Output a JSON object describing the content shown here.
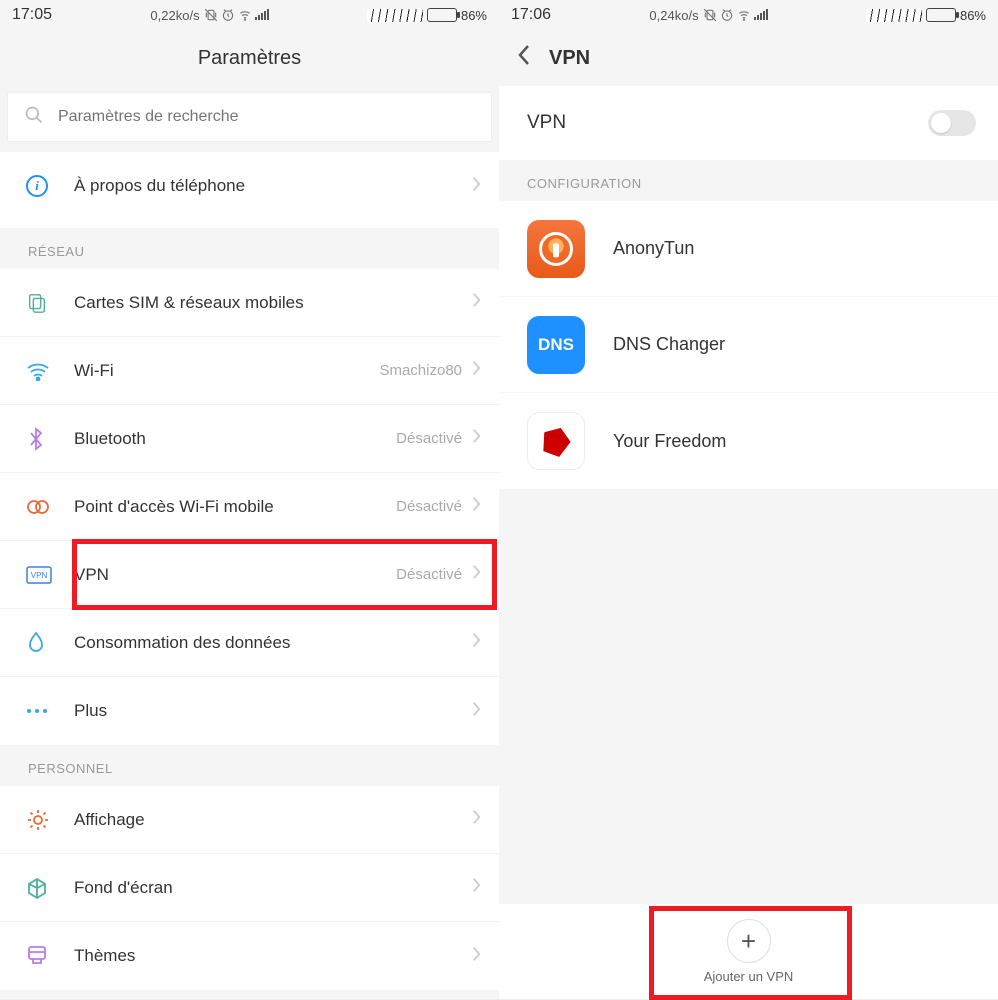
{
  "left": {
    "status": {
      "time": "17:05",
      "speed": "0,22ko/s",
      "battery": "86%"
    },
    "title": "Paramètres",
    "search_placeholder": "Paramètres de recherche",
    "about": "À propos du téléphone",
    "section_network": "RÉSEAU",
    "rows_network": [
      {
        "label": "Cartes SIM & réseaux mobiles",
        "value": ""
      },
      {
        "label": "Wi-Fi",
        "value": "Smachizo80"
      },
      {
        "label": "Bluetooth",
        "value": "Désactivé"
      },
      {
        "label": "Point d'accès Wi-Fi mobile",
        "value": "Désactivé"
      },
      {
        "label": "VPN",
        "value": "Désactivé"
      },
      {
        "label": "Consommation des données",
        "value": ""
      },
      {
        "label": "Plus",
        "value": ""
      }
    ],
    "section_personal": "PERSONNEL",
    "rows_personal": [
      {
        "label": "Affichage"
      },
      {
        "label": "Fond d'écran"
      },
      {
        "label": "Thèmes"
      }
    ]
  },
  "right": {
    "status": {
      "time": "17:06",
      "speed": "0,24ko/s",
      "battery": "86%"
    },
    "title": "VPN",
    "vpn_toggle_label": "VPN",
    "section_config": "CONFIGURATION",
    "apps": [
      {
        "name": "AnonyTun"
      },
      {
        "name": "DNS Changer"
      },
      {
        "name": "Your Freedom"
      }
    ],
    "dns_short": "DNS",
    "add_label": "Ajouter un VPN"
  }
}
